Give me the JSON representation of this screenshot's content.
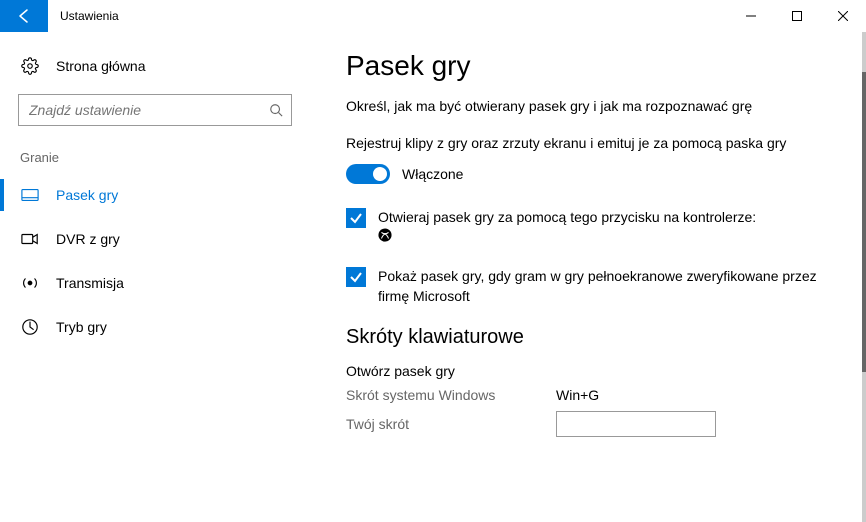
{
  "window": {
    "title": "Ustawienia"
  },
  "sidebar": {
    "home": "Strona główna",
    "search_placeholder": "Znajdź ustawienie",
    "group": "Granie",
    "items": [
      {
        "label": "Pasek gry"
      },
      {
        "label": "DVR z gry"
      },
      {
        "label": "Transmisja"
      },
      {
        "label": "Tryb gry"
      }
    ]
  },
  "content": {
    "title": "Pasek gry",
    "lead": "Określ, jak ma być otwierany pasek gry i jak ma rozpoznawać grę",
    "record_desc": "Rejestruj klipy z gry oraz zrzuty ekranu i emituj je za pomocą paska gry",
    "toggle_state": "Włączone",
    "cb1": "Otwieraj pasek gry za pomocą tego przycisku na kontrolerze:",
    "cb2": "Pokaż pasek gry, gdy gram w gry pełnoekranowe zweryfikowane przez firmę Microsoft",
    "shortcuts_heading": "Skróty klawiaturowe",
    "open_bar": "Otwórz pasek gry",
    "sys_shortcut_label": "Skrót systemu Windows",
    "sys_shortcut_value": "Win+G",
    "your_shortcut_label": "Twój skrót",
    "your_shortcut_value": ""
  }
}
